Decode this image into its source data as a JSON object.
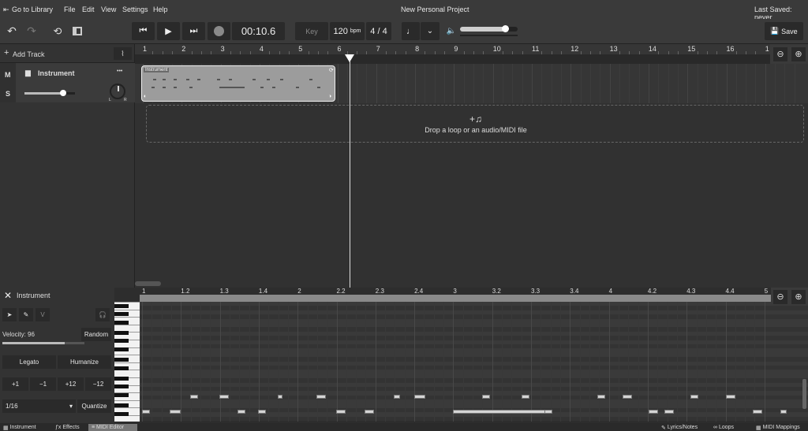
{
  "menu": {
    "go_to_library": "Go to Library",
    "file": "File",
    "edit": "Edit",
    "view": "View",
    "settings": "Settings",
    "help": "Help",
    "project_title": "New Personal Project",
    "last_saved": "Last Saved: never"
  },
  "transport": {
    "time": "00:10.6",
    "key_label": "Key",
    "bpm_value": "120",
    "bpm_unit": "bpm",
    "time_signature": "4 / 4",
    "volume_fraction": 0.78
  },
  "save_label": "Save",
  "tracks_panel": {
    "add_track": "Add Track",
    "mute": "M",
    "solo": "S",
    "track_name": "Instrument",
    "more": "•••",
    "pan_left": "L",
    "pan_right": "R",
    "track_volume_fraction": 0.77
  },
  "timeline": {
    "bars": [
      "1",
      "2",
      "3",
      "4",
      "5",
      "6",
      "7",
      "8",
      "9",
      "10",
      "11",
      "12",
      "13",
      "14",
      "15",
      "16",
      "1"
    ],
    "clip_label": "Instrument",
    "drop_text": "Drop a loop or an audio/MIDI file",
    "drop_icon": "+♫",
    "playhead_bar": 6.2
  },
  "editor": {
    "title": "Instrument",
    "velocity": "Velocity: 96",
    "velocity_fraction": 0.76,
    "random": "Random",
    "legato": "Legato",
    "humanize": "Humanize",
    "transpose": [
      "+1",
      "−1",
      "+12",
      "−12"
    ],
    "quantize_value": "1/16",
    "quantize": "Quantize",
    "v_tool": "V",
    "ruler": [
      "1",
      "1.2",
      "1.3",
      "1.4",
      "2",
      "2.2",
      "2.3",
      "2.4",
      "3",
      "3.2",
      "3.3",
      "3.4",
      "4",
      "4.2",
      "4.3",
      "4.4",
      "5"
    ],
    "zoom_out": "−",
    "zoom_in": "+"
  },
  "bottom_tabs": {
    "instrument": "Instrument",
    "effects": "Effects",
    "midi_editor": "MIDI Editor",
    "lyrics": "Lyrics/Notes",
    "loops": "Loops",
    "midi_mappings": "MIDI Mappings"
  }
}
